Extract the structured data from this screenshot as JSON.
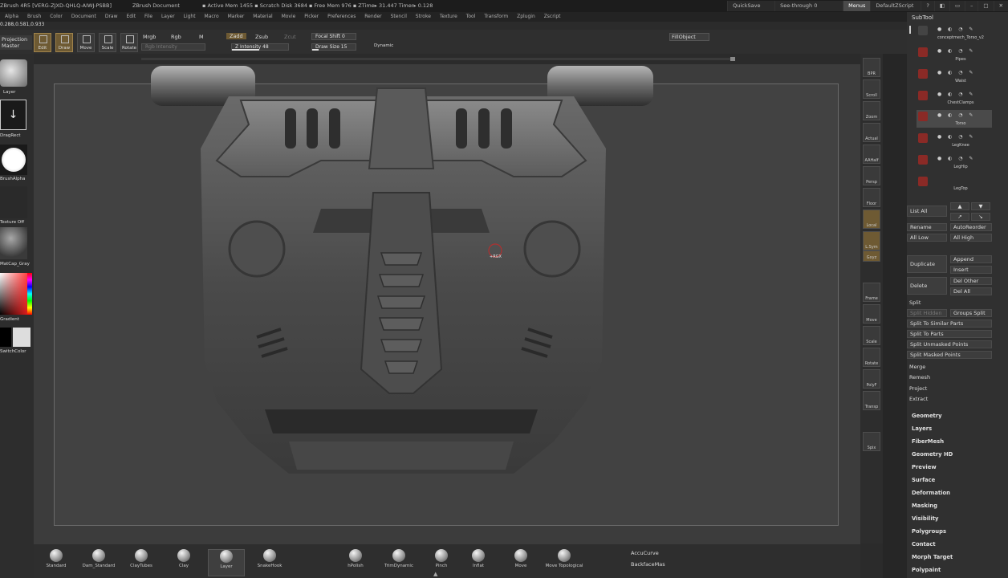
{
  "titlebar": {
    "app": "ZBrush 4R5 [VERG-ZJXD-QHLQ-AIWJ-PSBB]",
    "document": "ZBrush Document",
    "stats": "▪ Active Mem 1455 ▪ Scratch Disk 3684 ▪ Free Mem 976 ▪ ZTime▸ 31.447 Timer▸ 0.128",
    "quicksave": "QuickSave",
    "seethrough": "See-through  0",
    "menus": "Menus",
    "script": "DefaultZScript",
    "controls": [
      "?",
      "◧",
      "▭",
      "–",
      "□",
      "✕"
    ]
  },
  "menubar": [
    "Alpha",
    "Brush",
    "Color",
    "Document",
    "Draw",
    "Edit",
    "File",
    "Layer",
    "Light",
    "Macro",
    "Marker",
    "Material",
    "Movie",
    "Picker",
    "Preferences",
    "Render",
    "Stencil",
    "Stroke",
    "Texture",
    "Tool",
    "Transform",
    "Zplugin",
    "Zscript"
  ],
  "coords": "0.288,0.581,0.933",
  "topshelf": {
    "projection": "Projection",
    "master": "Master",
    "buttons": [
      "Edit",
      "Draw",
      "Move",
      "Scale",
      "Rotate"
    ],
    "mrgb": "Mrgb",
    "rgb": "Rgb",
    "m": "M",
    "rgb_intensity": "Rgb Intensity",
    "zadd": "Zadd",
    "zsub": "Zsub",
    "zcut": "Zcut",
    "z_intensity": "Z Intensity 48",
    "z_intensity_value": 48,
    "focal_shift": "Focal Shift 0",
    "draw_size": "Draw Size 15",
    "draw_size_value": 15,
    "dynamic": "Dynamic",
    "fillobject": "FillObject"
  },
  "leftpanel": {
    "labels": [
      "Layer",
      "DragRect",
      "BrushAlpha",
      "Texture Off",
      "MatCap_Gray",
      "Gradient",
      "SwitchColor"
    ]
  },
  "rightshelf": [
    "BPR",
    "Scroll",
    "Zoom",
    "Actual",
    "AAHalf",
    "Persp",
    "Floor",
    "Local",
    "L.Sym",
    "Gxyz",
    "Frame",
    "Move",
    "Scale",
    "Rotate",
    "PolyF",
    "Transp",
    "Spix"
  ],
  "subtool": {
    "title": "SubTool",
    "items": [
      {
        "name": "conceptmech_Torso_v2",
        "selected": false
      },
      {
        "name": "Pipes",
        "selected": false
      },
      {
        "name": "Waist",
        "selected": false
      },
      {
        "name": "ChestClamps",
        "selected": false
      },
      {
        "name": "Torso",
        "selected": true
      },
      {
        "name": "LegKnee",
        "selected": false
      },
      {
        "name": "LegHip",
        "selected": false
      },
      {
        "name": "LegTop",
        "selected": false
      }
    ],
    "list_all": "List All",
    "rename": "Rename",
    "autoreorder": "AutoReorder",
    "all_low": "All Low",
    "all_high": "All High",
    "duplicate": "Duplicate",
    "append": "Append",
    "insert": "Insert",
    "delete": "Delete",
    "del_other": "Del Other",
    "del_all": "Del All",
    "split": "Split",
    "split_hidden": "Split Hidden",
    "groups_split": "Groups Split",
    "split_similar": "Split To Similar Parts",
    "split_parts": "Split To Parts",
    "split_unmasked": "Split Unmasked Points",
    "split_masked": "Split Masked Points",
    "merge": "Merge",
    "remesh": "Remesh",
    "project": "Project",
    "extract": "Extract"
  },
  "tool_sections": [
    "Geometry",
    "Layers",
    "FiberMesh",
    "Geometry HD",
    "Preview",
    "Surface",
    "Deformation",
    "Masking",
    "Visibility",
    "Polygroups",
    "Contact",
    "Morph Target",
    "Polypaint"
  ],
  "brushes": [
    "Standard",
    "Dam_Standard",
    "ClayTubes",
    "Clay",
    "Layer",
    "SnakeHook",
    "hPolish",
    "TrimDynamic",
    "Pinch",
    "Inflat",
    "Move",
    "Move Topological"
  ],
  "bottom_right": {
    "accucurve": "AccuCurve",
    "backface": "BackfaceMas"
  },
  "cursor_label": "+RGX"
}
